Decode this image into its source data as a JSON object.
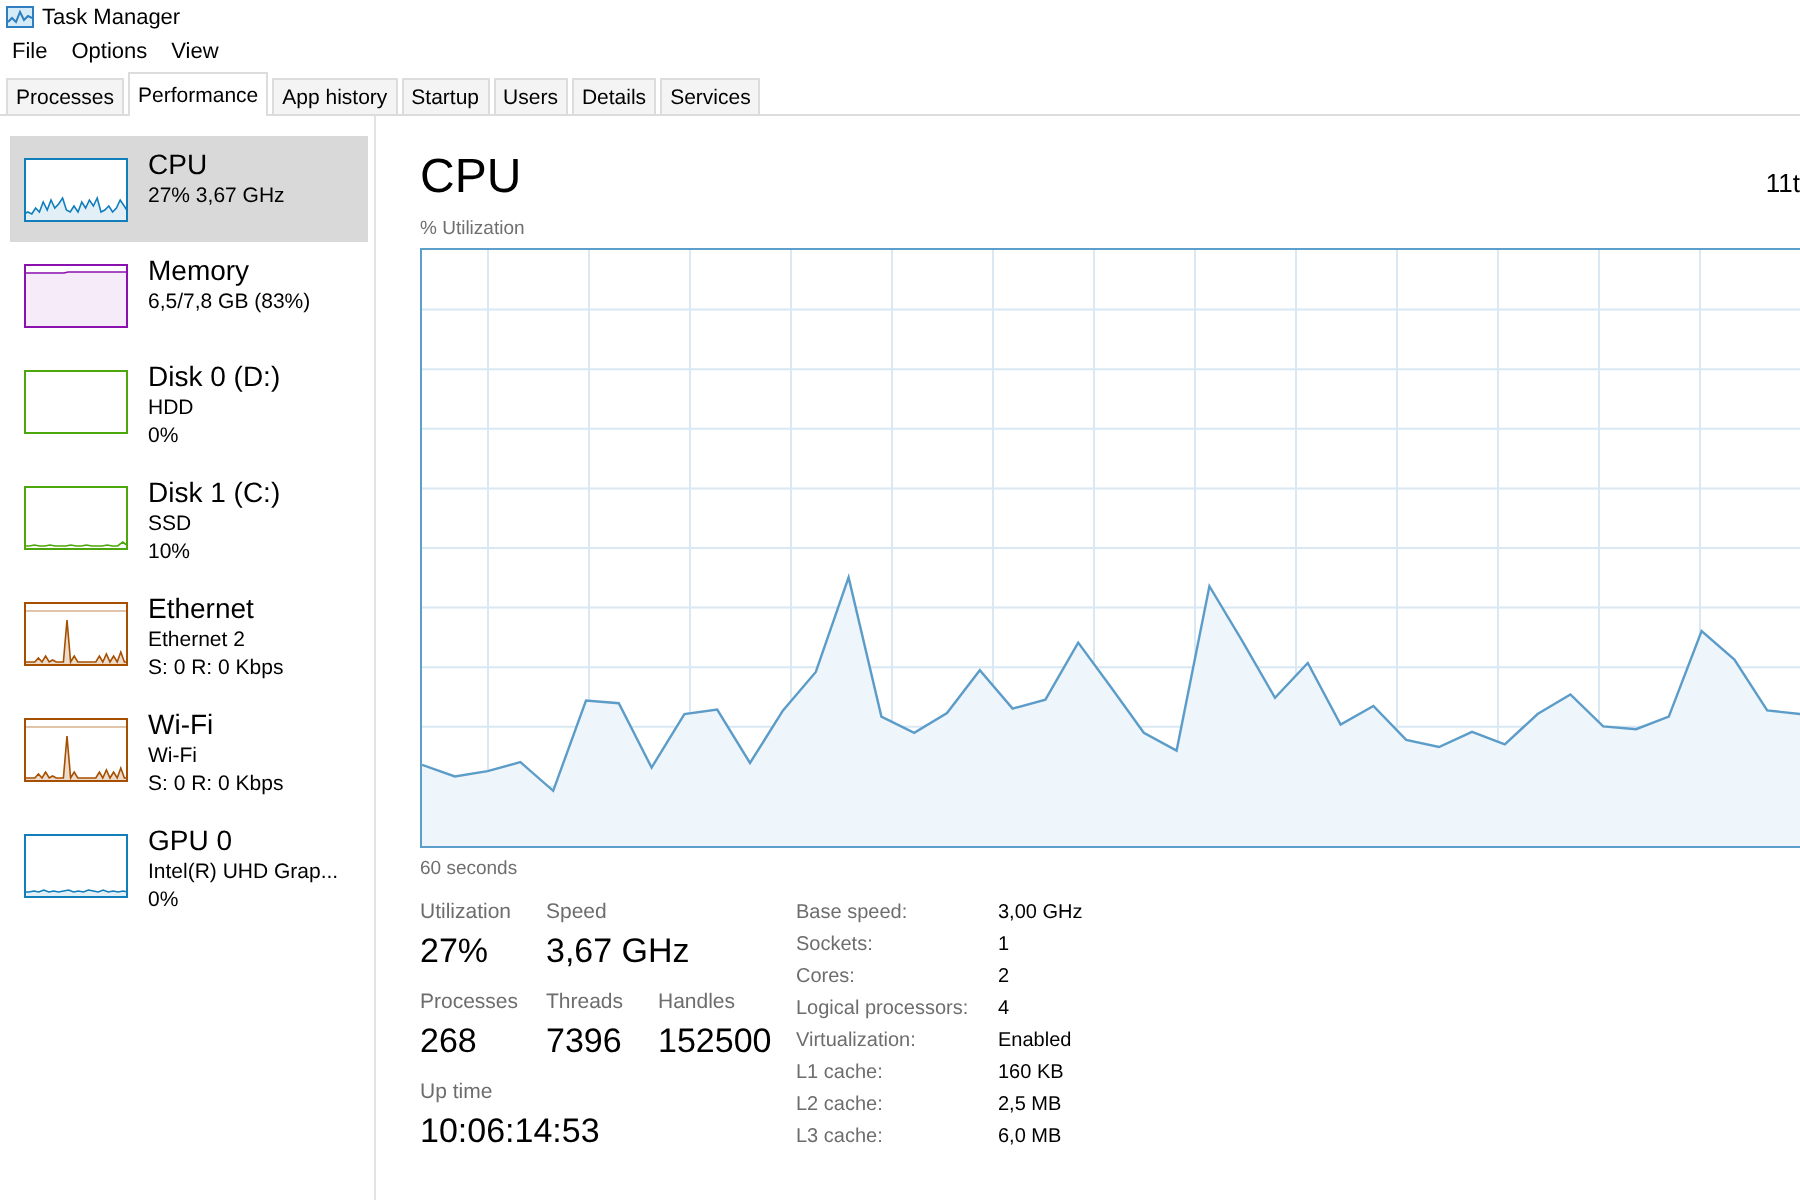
{
  "window": {
    "title": "Task Manager"
  },
  "menu": [
    "File",
    "Options",
    "View"
  ],
  "tabs": [
    {
      "label": "Processes",
      "selected": false
    },
    {
      "label": "Performance",
      "selected": true
    },
    {
      "label": "App history",
      "selected": false
    },
    {
      "label": "Startup",
      "selected": false
    },
    {
      "label": "Users",
      "selected": false
    },
    {
      "label": "Details",
      "selected": false
    },
    {
      "label": "Services",
      "selected": false
    }
  ],
  "sidebar": {
    "items": [
      {
        "title": "CPU",
        "lines": [
          "27% 3,67 GHz"
        ],
        "kind": "cpu",
        "color": "#117dbb",
        "selected": true
      },
      {
        "title": "Memory",
        "lines": [
          "6,5/7,8 GB (83%)"
        ],
        "kind": "memory",
        "color": "#8b12ae",
        "selected": false
      },
      {
        "title": "Disk 0 (D:)",
        "lines": [
          "HDD",
          "0%"
        ],
        "kind": "disk-idle",
        "color": "#4da60c",
        "selected": false
      },
      {
        "title": "Disk 1 (C:)",
        "lines": [
          "SSD",
          "10%"
        ],
        "kind": "disk",
        "color": "#4da60c",
        "selected": false
      },
      {
        "title": "Ethernet",
        "lines": [
          "Ethernet 2",
          "S: 0 R: 0 Kbps"
        ],
        "kind": "network",
        "color": "#a74f01",
        "selected": false
      },
      {
        "title": "Wi-Fi",
        "lines": [
          "Wi-Fi",
          "S: 0 R: 0 Kbps"
        ],
        "kind": "network",
        "color": "#a74f01",
        "selected": false
      },
      {
        "title": "GPU 0",
        "lines": [
          "Intel(R) UHD Grap...",
          "0%"
        ],
        "kind": "gpu",
        "color": "#117dbb",
        "selected": false
      }
    ]
  },
  "main": {
    "title": "CPU",
    "subtitle": "11t",
    "graph": {
      "ylabel": "% Utilization",
      "xlabel": "60 seconds"
    },
    "stats": [
      [
        {
          "label": "Utilization",
          "value": "27%"
        },
        {
          "label": "Speed",
          "value": "3,67 GHz"
        }
      ],
      [
        {
          "label": "Processes",
          "value": "268"
        },
        {
          "label": "Threads",
          "value": "7396"
        },
        {
          "label": "Handles",
          "value": "152500"
        }
      ],
      [
        {
          "label": "Up time",
          "value": "10:06:14:53"
        }
      ]
    ],
    "specs": [
      {
        "label": "Base speed:",
        "value": "3,00 GHz"
      },
      {
        "label": "Sockets:",
        "value": "1"
      },
      {
        "label": "Cores:",
        "value": "2"
      },
      {
        "label": "Logical processors:",
        "value": "4"
      },
      {
        "label": "Virtualization:",
        "value": "Enabled"
      },
      {
        "label": "L1 cache:",
        "value": "160 KB"
      },
      {
        "label": "L2 cache:",
        "value": "2,5 MB"
      },
      {
        "label": "L3 cache:",
        "value": "6,0 MB"
      }
    ]
  }
}
